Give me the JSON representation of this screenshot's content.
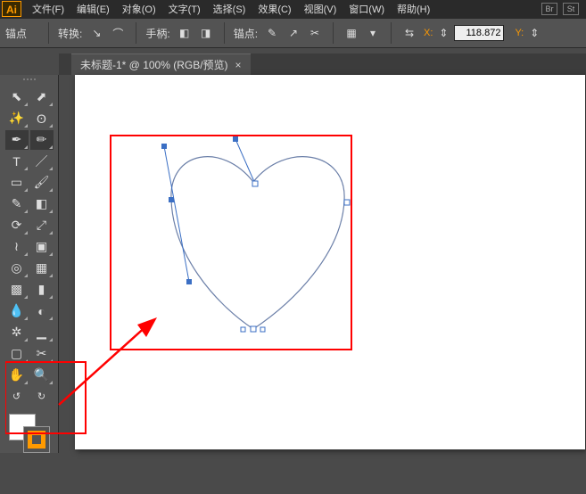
{
  "app": {
    "logo": "Ai"
  },
  "menu": {
    "file": "文件(F)",
    "edit": "编辑(E)",
    "object": "对象(O)",
    "type": "文字(T)",
    "select": "选择(S)",
    "effect": "效果(C)",
    "view": "视图(V)",
    "window": "窗口(W)",
    "help": "帮助(H)"
  },
  "badges": {
    "br": "Br",
    "st": "St"
  },
  "controlbar": {
    "context_label": "锚点",
    "convert_label": "转换:",
    "handles_label": "手柄:",
    "anchors_label": "锚点:",
    "x_label": "X:",
    "y_label": "Y:",
    "x_value": "118.872"
  },
  "tab": {
    "title": "未标题-1* @ 100% (RGB/预览)"
  },
  "tools": {
    "selection": "selection-tool",
    "direct": "direct-selection-tool",
    "wand": "magic-wand-tool",
    "lasso": "lasso-tool",
    "pen": "pen-tool",
    "curvature": "curvature-tool",
    "type": "type-tool",
    "line": "line-segment-tool",
    "rect": "rectangle-tool",
    "brush": "paintbrush-tool",
    "pencil": "pencil-tool",
    "eraser": "eraser-tool",
    "rotate": "rotate-tool",
    "scale": "scale-tool",
    "width": "width-tool",
    "free": "free-transform-tool",
    "shapebuilder": "shape-builder-tool",
    "perspective": "perspective-grid-tool",
    "mesh": "mesh-tool",
    "gradient": "gradient-tool",
    "eyedropper": "eyedropper-tool",
    "blend": "blend-tool",
    "symbol": "symbol-sprayer-tool",
    "graph": "column-graph-tool",
    "artboard": "artboard-tool",
    "slice": "slice-tool",
    "hand": "hand-tool",
    "zoom": "zoom-tool"
  }
}
